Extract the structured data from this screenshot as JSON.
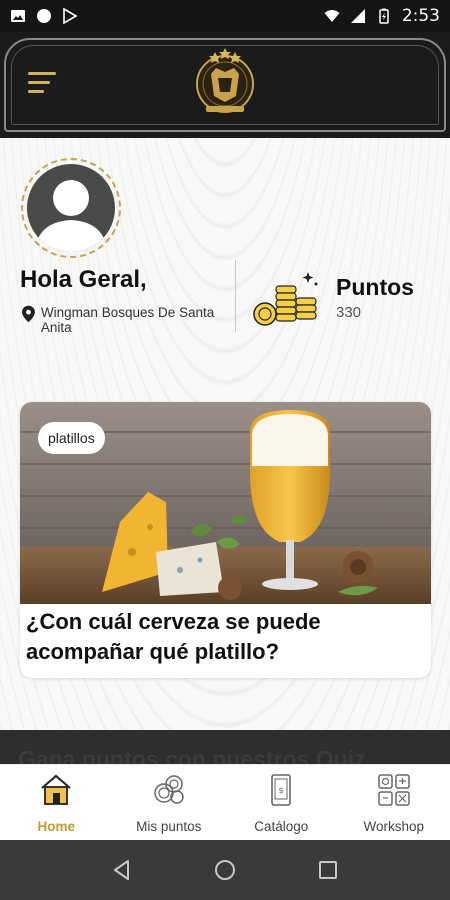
{
  "status_bar": {
    "time": "2:53"
  },
  "header": {
    "logo_icon": "crest-logo-icon",
    "menu_icon": "hamburger-menu-icon"
  },
  "profile": {
    "greeting": "Hola Geral,",
    "location": "Wingman Bosques De Santa Anita",
    "points_label": "Puntos",
    "points_value": "330"
  },
  "card": {
    "tag": "platillos",
    "title": "¿Con cuál cerveza se puede acompañar qué platillo?"
  },
  "quiz": {
    "title": "Gana puntos con nuestros Quiz"
  },
  "bottom_nav": {
    "items": [
      {
        "label": "Home",
        "icon": "home-icon",
        "active": true
      },
      {
        "label": "Mis puntos",
        "icon": "coins-icon",
        "active": false
      },
      {
        "label": "Catálogo",
        "icon": "catalog-phone-icon",
        "active": false
      },
      {
        "label": "Workshop",
        "icon": "workshop-icon",
        "active": false
      }
    ]
  },
  "colors": {
    "accent": "#c89a2e",
    "header_bg": "#1b1b1b",
    "nav_bg": "#3a3a3a"
  }
}
